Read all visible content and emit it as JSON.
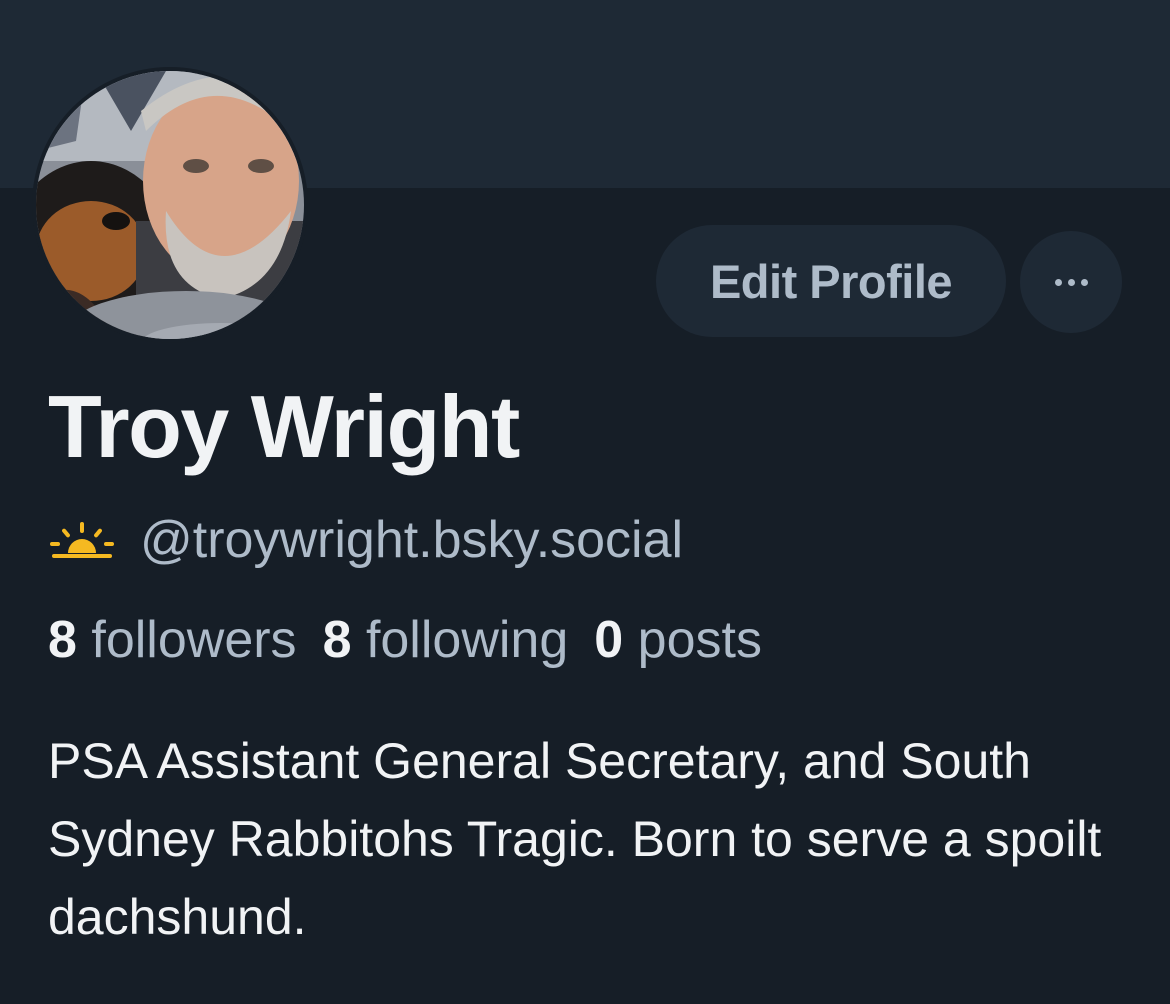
{
  "profile": {
    "display_name": "Troy Wright",
    "handle": "@troywright.bsky.social",
    "handle_icon": "sunrise-icon",
    "bio": "PSA Assistant General Secretary, and South Sydney Rabbitohs Tragic. Born to serve a spoilt dachshund.",
    "avatar_icon": "profile-photo"
  },
  "actions": {
    "edit_label": "Edit Profile",
    "more_icon": "more-icon"
  },
  "stats": {
    "followers_count": "8",
    "followers_label": "followers",
    "following_count": "8",
    "following_label": "following",
    "posts_count": "0",
    "posts_label": "posts"
  },
  "colors": {
    "background": "#161e27",
    "banner": "#1e2935",
    "button_bg": "#1e2935",
    "text_primary": "#f1f3f5",
    "text_secondary": "#aebbc9",
    "icon_accent": "#f5b921"
  }
}
